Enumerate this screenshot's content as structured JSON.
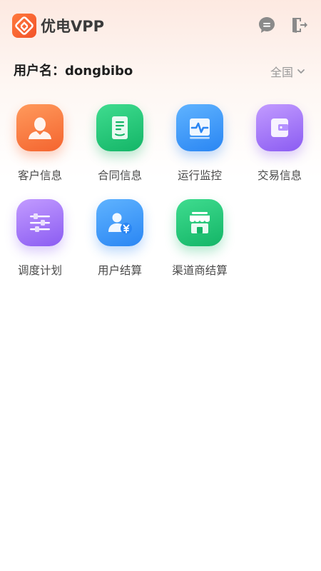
{
  "app": {
    "title": "优电VPP"
  },
  "header": {
    "message_icon": "message-icon",
    "logout_icon": "logout-icon",
    "logo_icon": "app-logo-icon"
  },
  "user": {
    "label": "用户名：dongbibo"
  },
  "region": {
    "selected": "全国"
  },
  "menu": {
    "items": [
      {
        "label": "客户信息",
        "icon": "customer-icon",
        "color": "#f4642f"
      },
      {
        "label": "合同信息",
        "icon": "contract-icon",
        "color": "#14b567"
      },
      {
        "label": "运行监控",
        "icon": "monitor-icon",
        "color": "#2a86f3"
      },
      {
        "label": "交易信息",
        "icon": "wallet-icon",
        "color": "#8b5cf2"
      },
      {
        "label": "调度计划",
        "icon": "sliders-icon",
        "color": "#8b5cf2"
      },
      {
        "label": "用户结算",
        "icon": "user-settlement-icon",
        "color": "#2a86f3"
      },
      {
        "label": "渠道商结算",
        "icon": "store-icon",
        "color": "#14b567"
      }
    ]
  }
}
